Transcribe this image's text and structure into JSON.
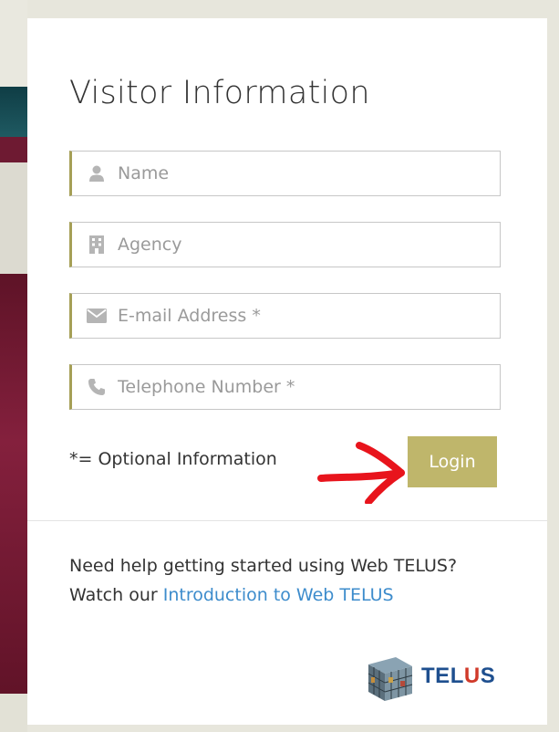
{
  "form": {
    "title": "Visitor Information",
    "fields": [
      {
        "icon": "user-icon",
        "placeholder": "Name"
      },
      {
        "icon": "building-icon",
        "placeholder": "Agency"
      },
      {
        "icon": "envelope-icon",
        "placeholder": "E-mail Address *"
      },
      {
        "icon": "phone-icon",
        "placeholder": "Telephone Number *"
      }
    ],
    "optional_note": "*= Optional Information",
    "login_label": "Login"
  },
  "help": {
    "line1": "Need help getting started using Web TELUS?",
    "line2_prefix": "Watch our ",
    "link_text": "Introduction to Web TELUS"
  },
  "logo": {
    "t": "T",
    "e": "E",
    "l": "L",
    "u": "U",
    "s": "S"
  },
  "colors": {
    "accent": "#a59f56",
    "button": "#bfb66b",
    "link": "#3d8ccc",
    "annotation_arrow": "#e8141c"
  }
}
